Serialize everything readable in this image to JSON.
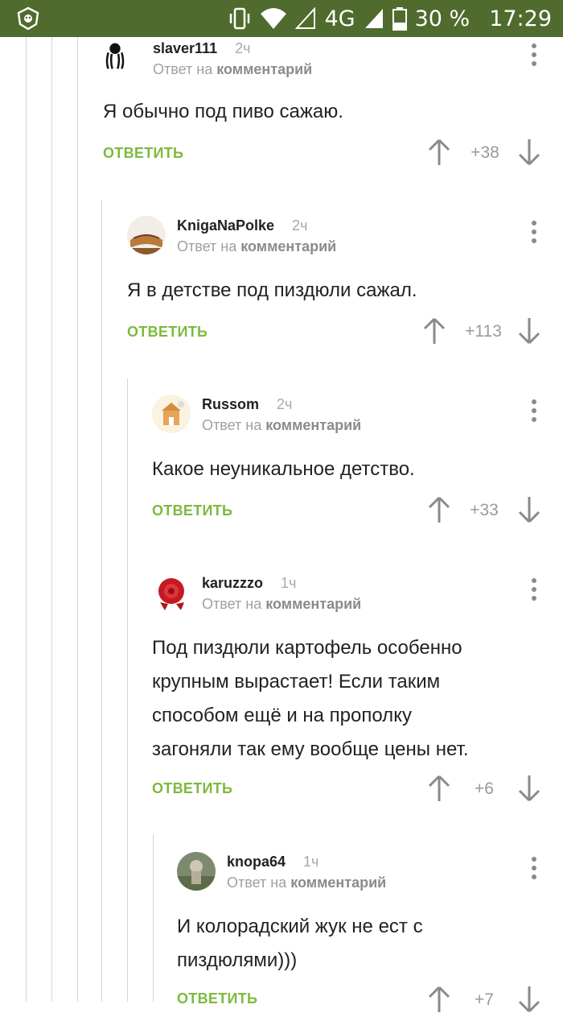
{
  "status_bar": {
    "network": "4G",
    "battery": "30 %",
    "time": "17:29",
    "bg_color": "#4f6b2d"
  },
  "reply_prefix": "Ответ на",
  "reply_target": "комментарий",
  "reply_label": "ОТВЕТИТЬ",
  "comments": [
    {
      "user": "slaver111",
      "time": "2ч",
      "text": "Я обычно под пиво сажаю.",
      "score": "+38"
    },
    {
      "user": "KnigaNaPolke",
      "time": "2ч",
      "text": "Я в детстве под пиздюли сажал.",
      "score": "+113"
    },
    {
      "user": "Russom",
      "time": "2ч",
      "text": "Какое неуникальное детство.",
      "score": "+33"
    },
    {
      "user": "karuzzzo",
      "time": "1ч",
      "text_lines": [
        "Под пиздюли картофель особенно",
        "крупным вырастает! Если таким",
        "способом ещё и на прополку",
        "загоняли так ему вообще цены нет."
      ],
      "score": "+6"
    },
    {
      "user": "knopa64",
      "time": "1ч",
      "text_lines": [
        "И колорадский жук не ест с",
        "пиздюлями)))"
      ],
      "score": "+7"
    }
  ]
}
